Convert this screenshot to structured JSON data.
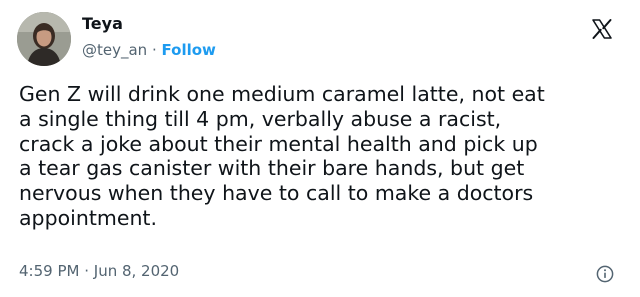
{
  "author": {
    "name": "Teya",
    "handle": "@tey_an",
    "separator": " · ",
    "follow_label": "Follow"
  },
  "icons": {
    "brand": "x-logo-icon",
    "info": "info-icon"
  },
  "tweet": {
    "lines": [
      "Gen Z will drink one medium caramel latte, not eat",
      "a single thing till 4 pm, verbally abuse a racist,",
      "crack a joke about their mental health and pick up",
      "a tear gas canister with their bare hands, but get",
      "nervous when they have to call to make a doctors",
      "appointment."
    ]
  },
  "meta": {
    "time": "4:59 PM",
    "separator": " · ",
    "date": "Jun 8, 2020"
  },
  "colors": {
    "text": "#0f1419",
    "secondary": "#536471",
    "accent": "#1d9bf0"
  }
}
